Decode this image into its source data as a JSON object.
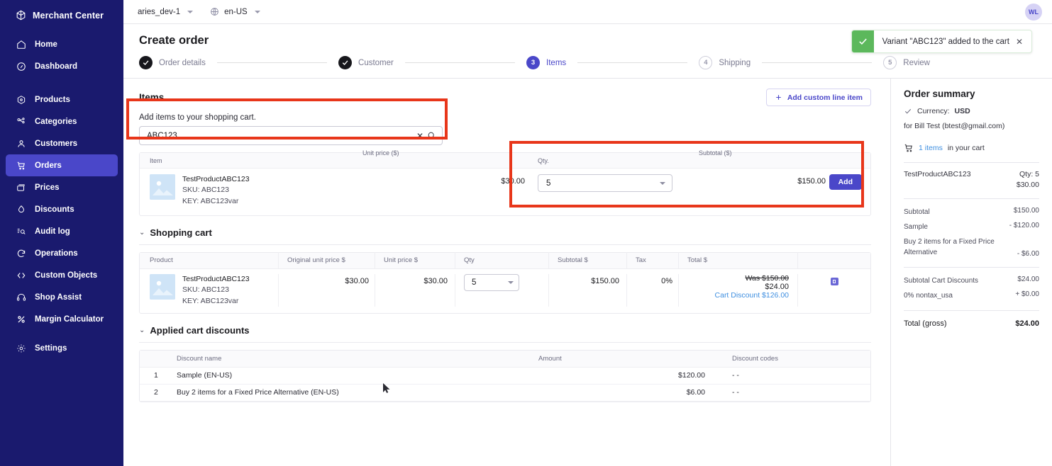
{
  "sidebar": {
    "brand": "Merchant Center",
    "brand_icon": "cube-icon",
    "groups": [
      {
        "items": [
          {
            "label": "Home",
            "icon": "home-icon",
            "active": false
          },
          {
            "label": "Dashboard",
            "icon": "dashboard-icon",
            "active": false
          }
        ]
      },
      {
        "items": [
          {
            "label": "Products",
            "icon": "products-icon",
            "active": false
          },
          {
            "label": "Categories",
            "icon": "categories-icon",
            "active": false
          },
          {
            "label": "Customers",
            "icon": "customers-icon",
            "active": false
          },
          {
            "label": "Orders",
            "icon": "orders-cart-icon",
            "active": true
          },
          {
            "label": "Prices",
            "icon": "prices-icon",
            "active": false
          },
          {
            "label": "Discounts",
            "icon": "discounts-icon",
            "active": false
          },
          {
            "label": "Audit log",
            "icon": "audit-log-icon",
            "active": false
          },
          {
            "label": "Operations",
            "icon": "operations-icon",
            "active": false
          },
          {
            "label": "Custom Objects",
            "icon": "code-brackets-icon",
            "active": false
          },
          {
            "label": "Shop Assist",
            "icon": "headset-icon",
            "active": false
          },
          {
            "label": "Margin Calculator",
            "icon": "percent-icon",
            "active": false
          }
        ]
      },
      {
        "items": [
          {
            "label": "Settings",
            "icon": "gear-icon",
            "active": false
          }
        ]
      }
    ]
  },
  "topbar": {
    "project": "aries_dev-1",
    "locale": "en-US",
    "locale_icon": "globe-icon",
    "avatar_initials": "WL"
  },
  "header": {
    "title": "Create order"
  },
  "toast": {
    "icon": "check-icon",
    "message": "Variant \"ABC123\" added to the cart",
    "close_icon": "close-icon"
  },
  "stepper": {
    "steps": [
      {
        "badge": "check",
        "label": "Order details",
        "state": "done"
      },
      {
        "badge": "check",
        "label": "Customer",
        "state": "done"
      },
      {
        "badge": "3",
        "label": "Items",
        "state": "current"
      },
      {
        "badge": "4",
        "label": "Shipping",
        "state": "todo"
      },
      {
        "badge": "5",
        "label": "Review",
        "state": "todo"
      }
    ]
  },
  "items_section": {
    "title": "Items",
    "add_custom_line_item": "Add custom line item",
    "add_custom_line_item_icon": "plus-icon",
    "search_label": "Add items to your shopping cart.",
    "search_value": "ABC123",
    "search_placeholder": "",
    "search_clear_icon": "close-icon",
    "search_icon": "search-icon",
    "results_headers": {
      "item": "Item",
      "unit_price": "Unit price ($)",
      "qty": "Qty.",
      "subtotal": "Subtotal ($)"
    },
    "result_row": {
      "name": "TestProductABC123",
      "sku": "SKU: ABC123",
      "key": "KEY: ABC123var",
      "unit_price": "$30.00",
      "qty": "5",
      "subtotal": "$150.00",
      "add_button": "Add",
      "thumb_icon": "image-placeholder-icon"
    }
  },
  "shopping_cart": {
    "title": "Shopping cart",
    "chevron_icon": "chevron-down-icon",
    "headers": {
      "product": "Product",
      "original_unit_price": "Original unit price $",
      "unit_price": "Unit price $",
      "qty": "Qty",
      "subtotal": "Subtotal $",
      "tax": "Tax",
      "total": "Total $"
    },
    "row": {
      "name": "TestProductABC123",
      "sku": "SKU: ABC123",
      "key": "KEY: ABC123var",
      "original_unit_price": "$30.00",
      "unit_price": "$30.00",
      "qty": "5",
      "subtotal": "$150.00",
      "tax": "0%",
      "total_was": "Was $150.00",
      "total_now": "$24.00",
      "cart_discount": "Cart Discount $126.00",
      "delete_icon": "trash-icon"
    }
  },
  "applied_discounts": {
    "title": "Applied cart discounts",
    "chevron_icon": "chevron-down-icon",
    "headers": {
      "index": "",
      "discount_name": "Discount name",
      "amount": "Amount",
      "discount_codes": "Discount codes"
    },
    "rows": [
      {
        "index": "1",
        "name": "Sample (EN-US)",
        "amount": "$120.00",
        "codes": "- -"
      },
      {
        "index": "2",
        "name": "Buy 2 items for a Fixed Price Alternative (EN-US)",
        "amount": "$6.00",
        "codes": "- -"
      }
    ]
  },
  "order_summary": {
    "title": "Order summary",
    "currency_check_icon": "check-icon",
    "currency_label": "Currency:",
    "currency_value": "USD",
    "customer_line": "for Bill Test (btest@gmail.com)",
    "cart_icon": "cart-icon",
    "cart_count": "1 items",
    "cart_suffix": "in your cart",
    "item_name": "TestProductABC123",
    "item_qty": "Qty: 5",
    "item_price": "$30.00",
    "lines": [
      {
        "label": "Subtotal",
        "value": "$150.00"
      },
      {
        "label": "Sample",
        "value": "- $120.00"
      },
      {
        "label": "Buy 2 items for a Fixed Price Alternative",
        "value": "- $6.00"
      }
    ],
    "lines2": [
      {
        "label": "Subtotal Cart Discounts",
        "value": "$24.00"
      },
      {
        "label": "0% nontax_usa",
        "value": "+ $0.00"
      }
    ],
    "total_label": "Total (gross)",
    "total_value": "$24.00"
  },
  "colors": {
    "sidebar_bg": "#1a1a6e",
    "accent": "#4a47c9",
    "highlight": "#e8361a",
    "toast_green": "#5cb85c",
    "link_blue": "#3f8fe0"
  }
}
